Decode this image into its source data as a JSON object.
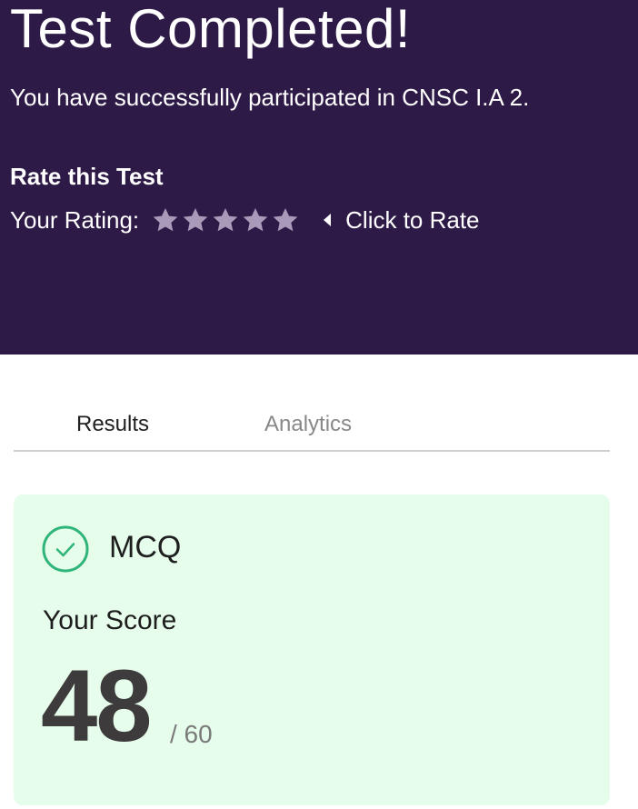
{
  "header": {
    "title": "Test Completed!",
    "subtitle": "You have successfully participated in CNSC I.A 2.",
    "rate_heading": "Rate this Test",
    "rating_label": "Your Rating:",
    "rating": 0,
    "rating_max": 5,
    "click_to_rate": "Click to Rate"
  },
  "tabs": [
    {
      "label": "Results",
      "active": true
    },
    {
      "label": "Analytics",
      "active": false
    }
  ],
  "result_card": {
    "section": "MCQ",
    "score_label": "Your Score",
    "score": "48",
    "total": "/ 60"
  },
  "colors": {
    "header_bg": "#2e1a47",
    "star": "#a89ab8",
    "card_bg": "#e6fdec",
    "check": "#2fb57a"
  },
  "icons": {
    "star": "star-icon",
    "caret": "caret-left-icon",
    "check": "check-circle-icon"
  }
}
